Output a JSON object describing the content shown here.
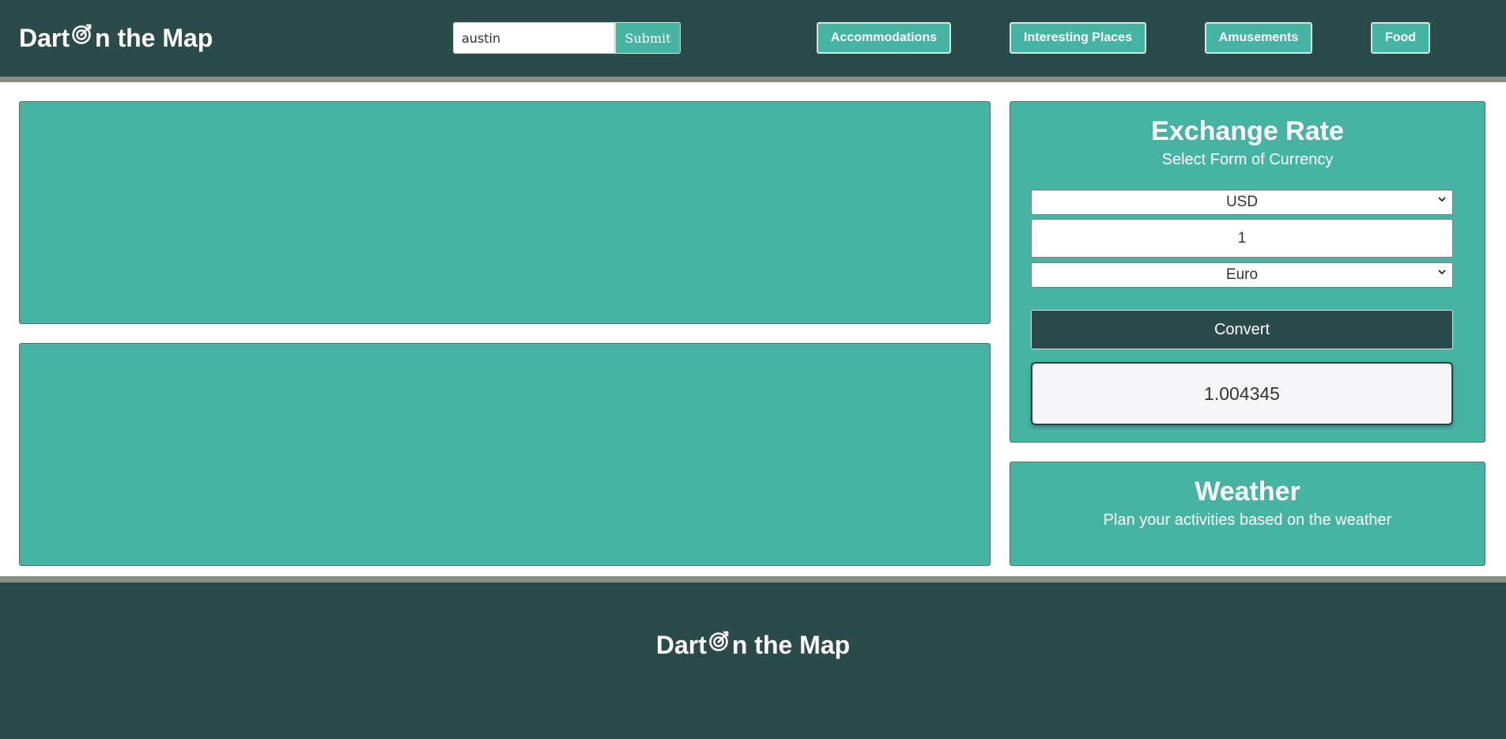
{
  "header": {
    "brand_prefix": "Dart ",
    "brand_suffix": "n the Map",
    "search": {
      "value": "austin",
      "submit_label": "Submit"
    },
    "nav": [
      {
        "label": "Accommodations"
      },
      {
        "label": "Interesting Places"
      },
      {
        "label": "Amusements"
      },
      {
        "label": "Food"
      }
    ]
  },
  "exchange": {
    "title": "Exchange Rate",
    "subtitle": "Select Form of Currency",
    "from_currency": "USD",
    "amount": "1",
    "to_currency": "Euro",
    "convert_label": "Convert",
    "result": "1.004345"
  },
  "weather": {
    "title": "Weather",
    "subtitle": "Plan your activities based on the weather"
  },
  "footer": {
    "brand_prefix": "Dart ",
    "brand_suffix": "n the Map"
  },
  "colors": {
    "header_bg": "#2b4a4a",
    "accent": "#46b3a3",
    "stripe": "#8a8f84"
  },
  "icons": {
    "brand_icon": "bullseye-arrow-icon",
    "select_icon": "chevron-down-icon"
  }
}
